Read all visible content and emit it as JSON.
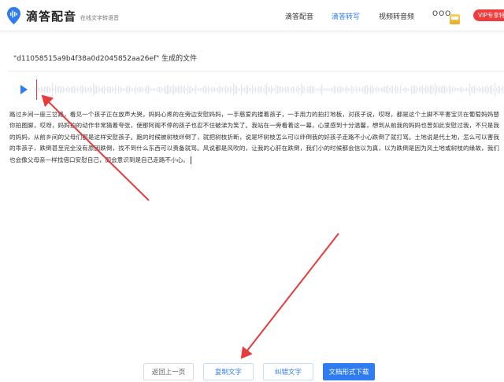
{
  "header": {
    "brand_name": "滴答配音",
    "brand_tagline": "在线文字转语音",
    "nav": [
      {
        "label": "滴答配音",
        "active": false
      },
      {
        "label": "滴答转写",
        "active": true
      },
      {
        "label": "视频转音频",
        "active": false
      }
    ],
    "user_name": "OOO",
    "vip_label": "VIP专享特"
  },
  "file": {
    "title": "\"d11058515a9b4f38a0d2045852aa26ef\" 生成的文件"
  },
  "player": {
    "progress": 0.0
  },
  "transcript": {
    "text": "路过乡间一座三岔路，看见一个孩子正在放声大哭，妈妈心疼的在旁边安慰妈妈，一手慈爱的搂着孩子，一手用力的拍打地板，对孩子说，哎呀，都是这个土脚不平害宝贝在葡萄妈妈替你拍图脚，哎呀，妈妈拍的动作非常猜着夸张，使那阿阁不停的孩子也忍不住破涕为笑了。我站在一旁看着这一幕，心里感到十分温馨，想到从前我的妈妈也曾如此安慰过我，不只是我的妈妈，从前乡间的父母们都是这样安慰孩子。跑的时候被树枝绊倒了，就把树枝折断，说是坏树枝怎么可以绊倒我的好孩子走路不小心跌倒了就打骂。土地说是代土地，怎么可以害我的乖孩子，跌倒甚至完全没有原因跌倒，找不到什么东西可以责备就骂。风说都是风吹的，让我的心肝在跌倒，我们小的时候都会信以为真，以为跌倒是因为风土地或树枝的缘故，我们也会像父母亲一样找借口安慰自己，即会意识到是自己走路不小心。"
  },
  "buttons": {
    "back": "返回上一页",
    "copy": "复制文字",
    "correct": "纠错文字",
    "download": "文档形式下载"
  },
  "colors": {
    "accent": "#2f7cf0",
    "vip": "#ef3d3d",
    "annotation": "#e63c3c",
    "wave": "#e2e6ed"
  }
}
